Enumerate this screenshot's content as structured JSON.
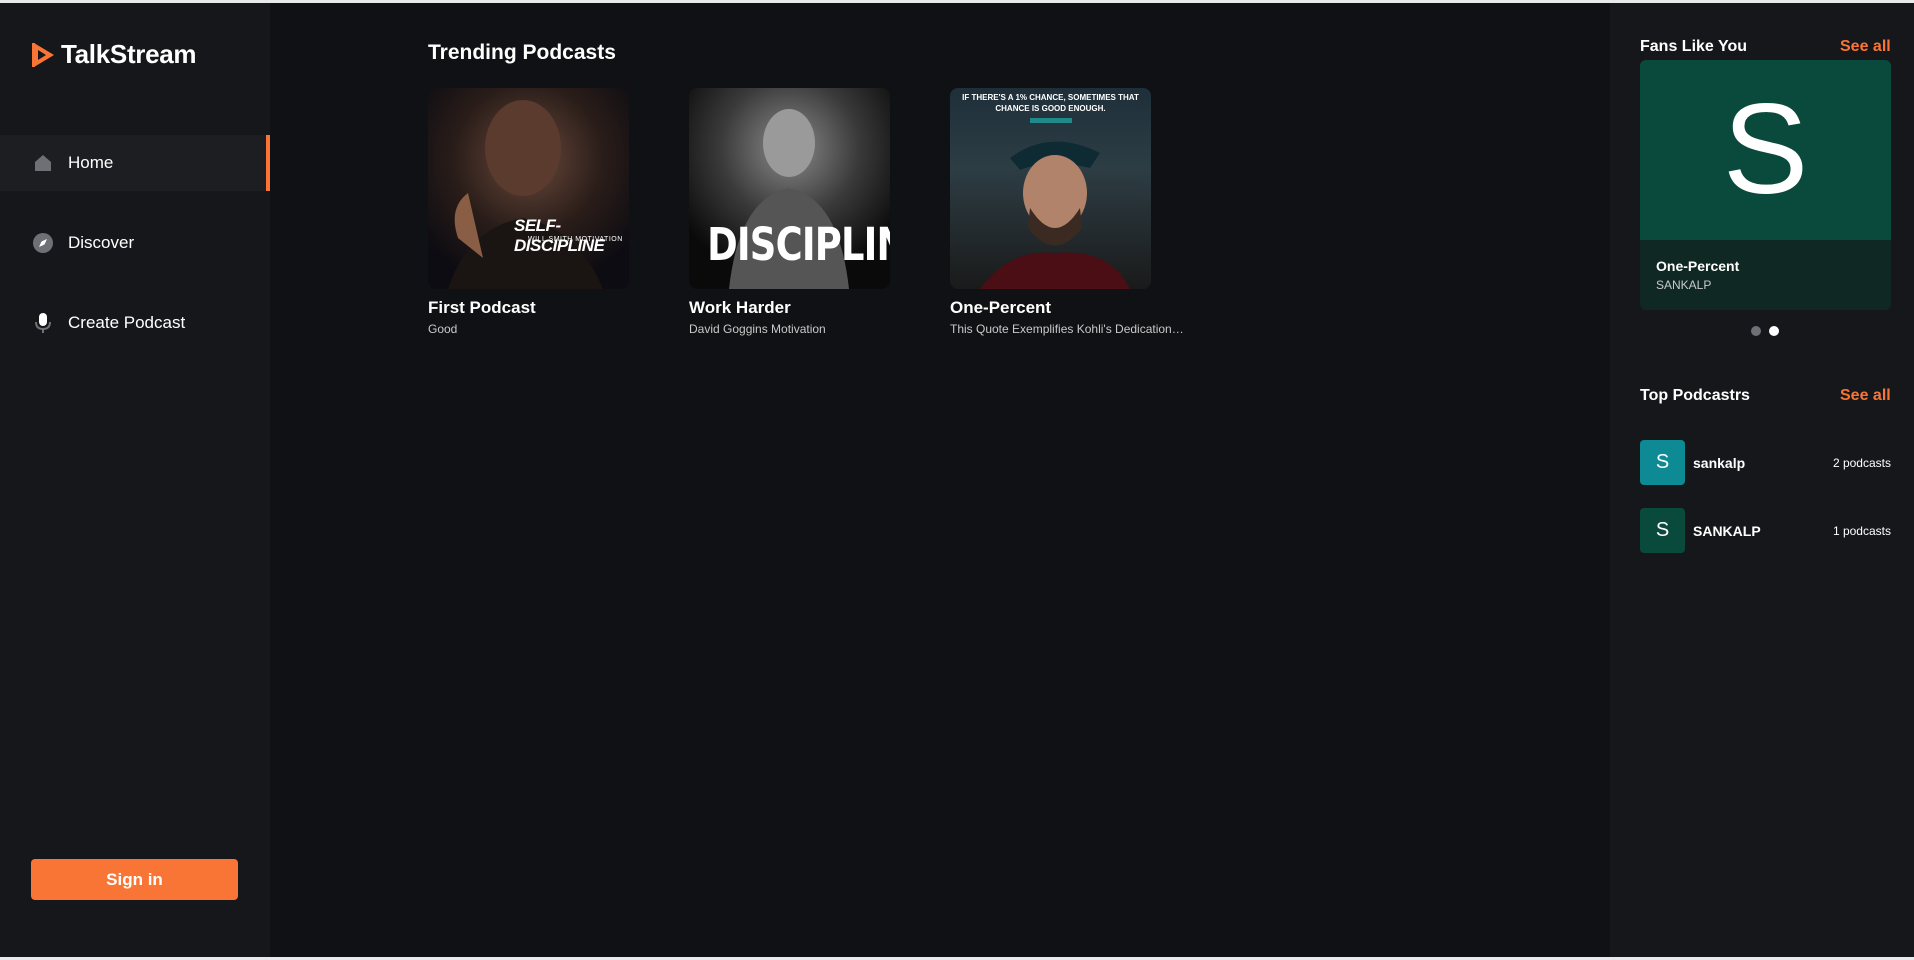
{
  "app": {
    "name": "TalkStream",
    "accent_color": "#f97535"
  },
  "sidebar": {
    "items": [
      {
        "label": "Home",
        "icon": "home-icon",
        "active": true
      },
      {
        "label": "Discover",
        "icon": "compass-icon",
        "active": false
      },
      {
        "label": "Create Podcast",
        "icon": "microphone-icon",
        "active": false
      }
    ],
    "signin_label": "Sign in"
  },
  "main": {
    "title": "Trending Podcasts",
    "podcasts": [
      {
        "title": "First Podcast",
        "subtitle": "Good",
        "cover_text": "SELF-DISCIPLINE",
        "cover_subtext": "WILL SMITH MOTIVATION"
      },
      {
        "title": "Work Harder",
        "subtitle": "David Goggins Motivation",
        "cover_text": "DISCIPLINE"
      },
      {
        "title": "One-Percent",
        "subtitle": "This Quote Exemplifies Kohli's Dedication ...",
        "cover_text": "IF THERE'S A 1% CHANCE, SOMETIMES THAT CHANCE IS GOOD ENOUGH."
      }
    ]
  },
  "right": {
    "fans": {
      "title": "Fans Like You",
      "see_all": "See all",
      "card": {
        "letter": "S",
        "name": "One-Percent",
        "owner": "SANKALP",
        "color": "#0a4a3c"
      },
      "dots": [
        {
          "active": false
        },
        {
          "active": true
        }
      ]
    },
    "top": {
      "title": "Top Podcastrs",
      "see_all": "See all",
      "items": [
        {
          "letter": "S",
          "name": "sankalp",
          "count": "2 podcasts",
          "color": "#0e8a94"
        },
        {
          "letter": "S",
          "name": "SANKALP",
          "count": "1 podcasts",
          "color": "#0a4a3c"
        }
      ]
    }
  }
}
